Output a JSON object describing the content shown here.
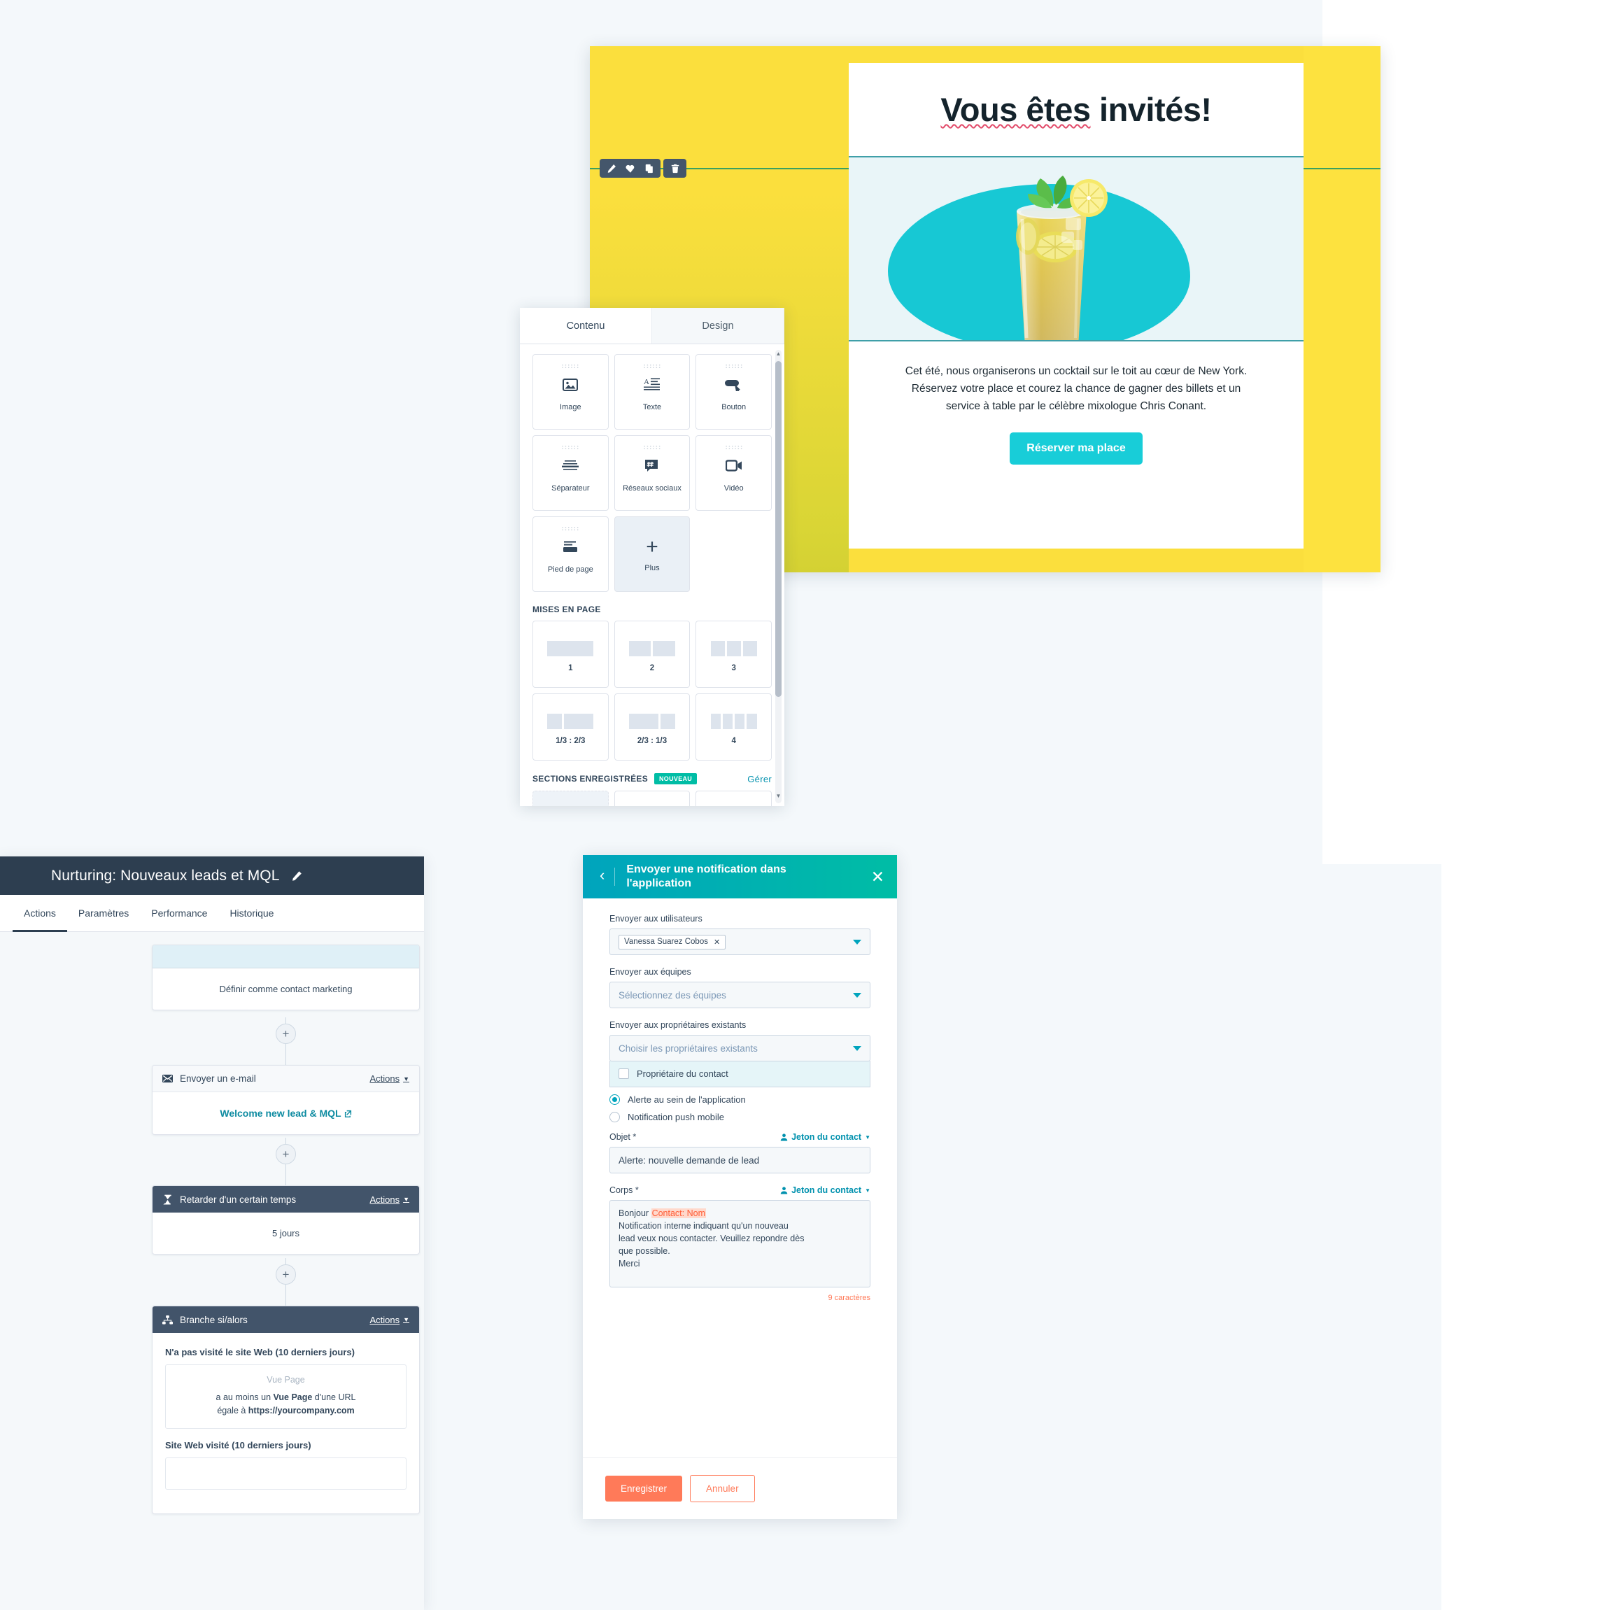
{
  "email_preview": {
    "title_plain": "Vous êtes invités!",
    "title_part_a": "Vous êtes",
    "title_part_b": " invités!",
    "body_line_1": "Cet été, nous organiserons un cocktail sur le toit au cœur de New York.",
    "body_line_2": "Réservez votre place et courez la chance de gagner des billets et un",
    "body_line_3": "service à table par le célèbre mixologue Chris Conant.",
    "cta_label": "Réserver ma place",
    "toolbar": {
      "edit": "pencil-icon",
      "favorite": "heart-icon",
      "duplicate": "copy-icon",
      "delete": "trash-icon"
    },
    "colors": {
      "yellow": "#fbdf3d",
      "yellow_dark": "#d4d133",
      "teal": "#17c8d4",
      "cta": "#18cdd8",
      "image_bg": "#e9f5f8"
    }
  },
  "content_panel": {
    "tabs": [
      {
        "label": "Contenu",
        "active": true
      },
      {
        "label": "Design",
        "active": false
      }
    ],
    "modules": [
      {
        "label": "Image",
        "icon": "image-icon"
      },
      {
        "label": "Texte",
        "icon": "text-icon"
      },
      {
        "label": "Bouton",
        "icon": "button-icon"
      },
      {
        "label": "Séparateur",
        "icon": "divider-icon"
      },
      {
        "label": "Réseaux sociaux",
        "icon": "social-icon"
      },
      {
        "label": "Vidéo",
        "icon": "video-icon"
      },
      {
        "label": "Pied de page",
        "icon": "footer-icon"
      },
      {
        "label": "Plus",
        "icon": "plus-icon"
      }
    ],
    "layouts_heading": "MISES EN PAGE",
    "layouts": [
      {
        "label": "1",
        "cols": [
          1
        ]
      },
      {
        "label": "2",
        "cols": [
          1,
          1
        ]
      },
      {
        "label": "3",
        "cols": [
          1,
          1,
          1
        ]
      },
      {
        "label": "1/3 : 2/3",
        "cols": [
          1,
          2
        ]
      },
      {
        "label": "2/3 : 1/3",
        "cols": [
          2,
          1
        ]
      },
      {
        "label": "4",
        "cols": [
          1,
          1,
          1,
          1
        ]
      }
    ],
    "saved_heading": "SECTIONS ENREGISTRÉES",
    "saved_badge": "NOUVEAU",
    "saved_manage": "Gérer"
  },
  "workflow": {
    "title": "Nurturing: Nouveaux leads et MQL",
    "edit_icon": "pencil-icon",
    "tabs": [
      {
        "label": "Actions",
        "active": true
      },
      {
        "label": "Paramètres",
        "active": false
      },
      {
        "label": "Performance",
        "active": false
      },
      {
        "label": "Historique",
        "active": false
      }
    ],
    "nodes": [
      {
        "id": "set-marketing-contact",
        "header_style": "blue",
        "header_title": "",
        "body_text": "Définir comme contact marketing"
      },
      {
        "id": "send-email",
        "header_style": "light",
        "header_icon": "envelope-icon",
        "header_title": "Envoyer un e-mail",
        "actions_label": "Actions",
        "link_text": "Welcome new lead & MQL"
      },
      {
        "id": "delay",
        "header_style": "dark",
        "header_icon": "hourglass-icon",
        "header_title": "Retarder d'un certain temps",
        "actions_label": "Actions",
        "body_text": "5 jours"
      },
      {
        "id": "if-then-branch",
        "header_style": "dark",
        "header_icon": "branch-icon",
        "header_title": "Branche si/alors",
        "actions_label": "Actions",
        "condition_1_label": "N'a pas visité le site Web (10 derniers jours)",
        "condition_1_title": "Vue Page",
        "condition_1_text_a": "a au moins un ",
        "condition_1_text_b": "Vue Page",
        "condition_1_text_c": " d'une URL",
        "condition_1_text_d": "égale à ",
        "condition_1_text_e": "https://yourcompany.com",
        "condition_2_label": "Site Web visité (10 derniers jours)"
      }
    ]
  },
  "notification_panel": {
    "header_title": "Envoyer une notification dans l'application",
    "back_icon": "chevron-left-icon",
    "close_icon": "close-icon",
    "fields": {
      "users_label": "Envoyer aux utilisateurs",
      "users_chip": "Vanessa Suarez Cobos",
      "teams_label": "Envoyer aux équipes",
      "teams_placeholder": "Sélectionnez des équipes",
      "owners_label": "Envoyer aux propriétaires existants",
      "owners_placeholder": "Choisir les propriétaires existants",
      "owner_checkbox_label": "Propriétaire du contact",
      "radio_app_alert": "Alerte au sein de l'application",
      "radio_push": "Notification push mobile",
      "subject_label": "Objet *",
      "subject_token_link": "Jeton du contact",
      "subject_value": "Alerte: nouvelle demande de lead",
      "body_label": "Corps *",
      "body_token_link": "Jeton du contact",
      "body_greeting": "Bonjour ",
      "body_token": "Contact: Nom",
      "body_line_1": "Notification interne indiquant qu'un nouveau",
      "body_line_2": "lead veux nous contacter. Veuillez repondre dès",
      "body_line_3": "que possible.",
      "body_line_4": "Merci",
      "char_count": "9 caractères"
    },
    "footer": {
      "save_label": "Enregistrer",
      "cancel_label": "Annuler"
    },
    "colors": {
      "header_start": "#00a4bd",
      "header_end": "#00bda5",
      "primary_button": "#ff7a59",
      "token_highlight": "#ff5c35"
    }
  }
}
